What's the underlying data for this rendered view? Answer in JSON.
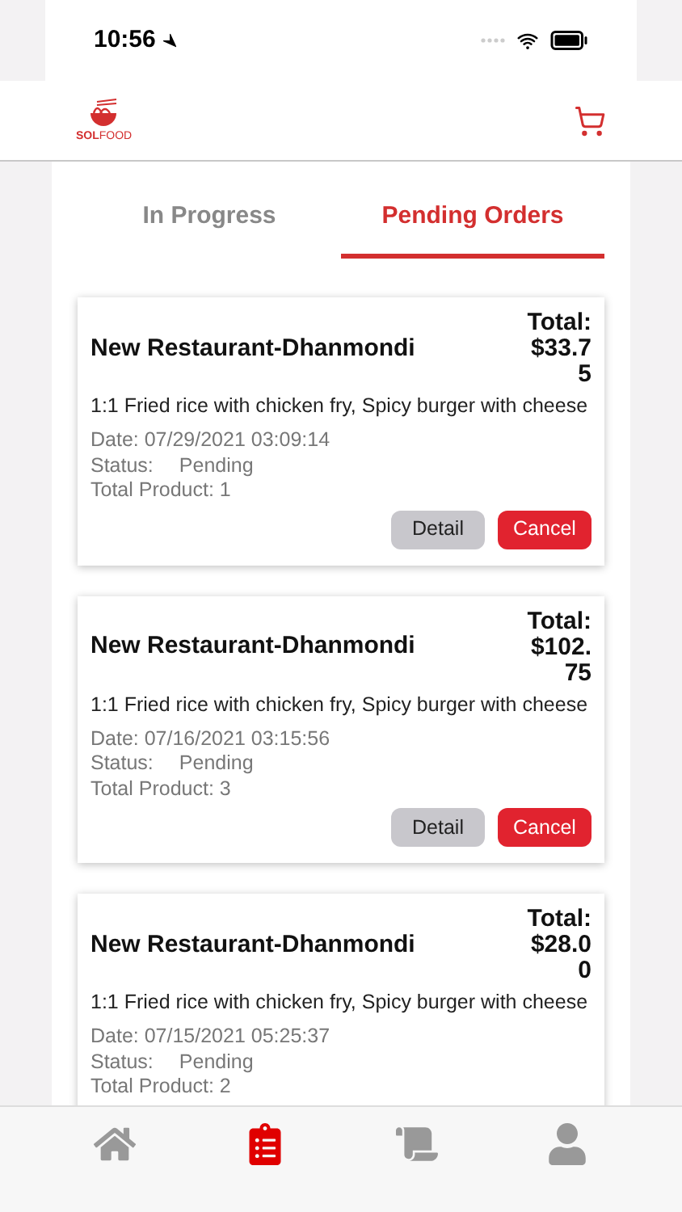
{
  "status_bar": {
    "time": "10:56"
  },
  "header": {
    "logo_text_bold": "SOL",
    "logo_text_light": "FOOD"
  },
  "tabs": [
    {
      "label": "In Progress",
      "selected": false
    },
    {
      "label": "Pending Orders",
      "selected": true
    }
  ],
  "orders": [
    {
      "restaurant": "New Restaurant-Dhanmondi",
      "total_label": "Total:",
      "total": "$33.75",
      "items": "1:1 Fried rice with chicken fry, Spicy burger with cheese",
      "date": "Date: 07/29/2021 03:09:14",
      "status_label": "Status:",
      "status": "Pending",
      "total_product": "Total Product: 1",
      "buttons": [
        "Detail",
        "Cancel"
      ]
    },
    {
      "restaurant": "New Restaurant-Dhanmondi",
      "total_label": "Total:",
      "total": "$102.75",
      "items": "1:1 Fried rice with chicken fry, Spicy burger with cheese",
      "date": "Date: 07/16/2021 03:15:56",
      "status_label": "Status:",
      "status": "Pending",
      "total_product": "Total Product: 3",
      "buttons": [
        "Detail",
        "Cancel"
      ]
    },
    {
      "restaurant": "New Restaurant-Dhanmondi",
      "total_label": "Total:",
      "total": "$28.00",
      "items": "1:1 Fried rice with chicken fry, Spicy burger with cheese",
      "date": "Date: 07/15/2021 05:25:37",
      "status_label": "Status:",
      "status": "Pending",
      "total_product": "Total Product: 2"
    }
  ],
  "bottom_nav": [
    {
      "kind": "home",
      "selected": false
    },
    {
      "kind": "orders",
      "selected": true
    },
    {
      "kind": "receipt",
      "selected": false
    },
    {
      "kind": "profile",
      "selected": false
    }
  ]
}
